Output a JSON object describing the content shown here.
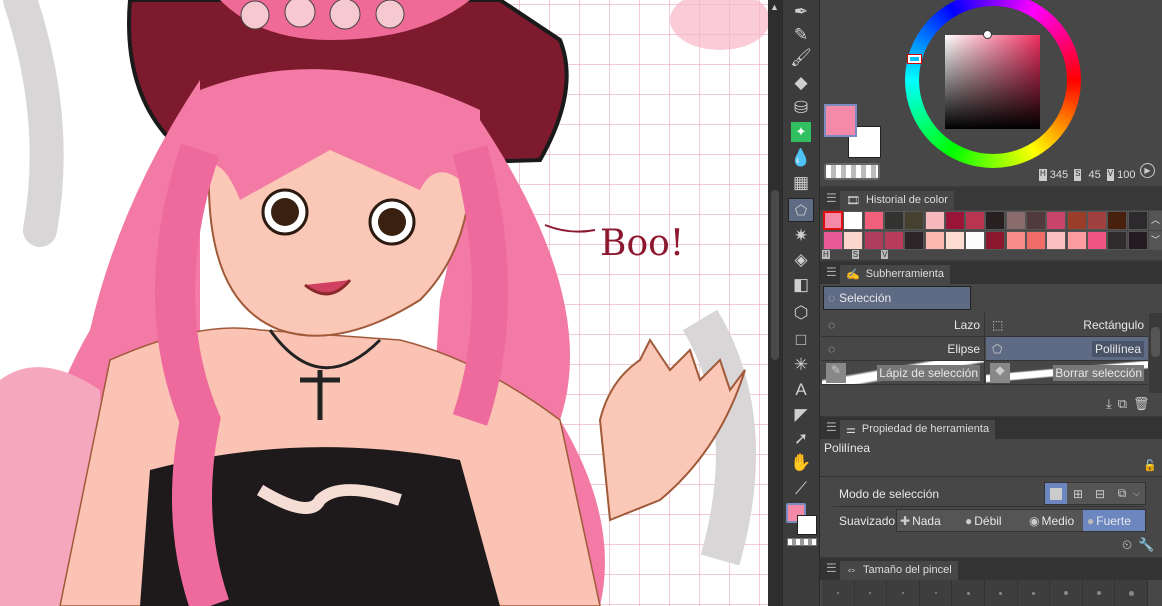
{
  "canvas": {
    "speech_text": "Boo!"
  },
  "toolbar": {
    "tools": [
      "pen",
      "pencil",
      "brush",
      "eraser",
      "airbrush",
      "decoration",
      "blend",
      "figure-ruler",
      "selection",
      "auto-select",
      "fill",
      "gradient",
      "3d-object",
      "figure",
      "frame",
      "text",
      "balloon",
      "operation",
      "hand",
      "eyedropper"
    ],
    "active": "selection"
  },
  "color_wheel": {
    "h_label": "H",
    "h": "345",
    "s_label": "S",
    "s": "45",
    "v_label": "V",
    "v": "100",
    "main_color": "#f48aa8",
    "sub_color": "#ffffff"
  },
  "color_history": {
    "title": "Historial de color",
    "labels": [
      "H",
      "S",
      "V"
    ],
    "row1": [
      "#f48aa8",
      "#ffffff",
      "#f0607a",
      "#323230",
      "#454030",
      "#f6b8bc",
      "#9a1438",
      "#b83450",
      "#282020",
      "#8a6c6c",
      "#503a3e",
      "#c84468",
      "#9a3e2a",
      "#a04040",
      "#48200e",
      "#2c2a2c"
    ],
    "row2": [
      "#e85a98",
      "#fcd6cc",
      "#b03c5c",
      "#b83c5c",
      "#2c2628",
      "#fcb8b0",
      "#fcdcd0",
      "#fcfcfc",
      "#8c1830",
      "#f88c88",
      "#f06c68",
      "#fcc0c4",
      "#fc9ca0",
      "#f05480",
      "#302c2e",
      "#241c20"
    ]
  },
  "subtool": {
    "title": "Subherramienta",
    "group": "Selección",
    "items": [
      "Lazo",
      "Rectángulo",
      "Elipse",
      "Polilínea",
      "Lápiz de selección",
      "Borrar selección"
    ],
    "selected": "Polilínea"
  },
  "tool_property": {
    "title": "Propiedad de herramienta",
    "tool_name": "Polilínea",
    "mode_label": "Modo de selección",
    "smooth_label": "Suavizado",
    "smooth_options": [
      "Nada",
      "Débil",
      "Medio",
      "Fuerte"
    ],
    "smooth_selected": "Fuerte"
  },
  "brush_size": {
    "title": "Tamaño del pincel"
  }
}
